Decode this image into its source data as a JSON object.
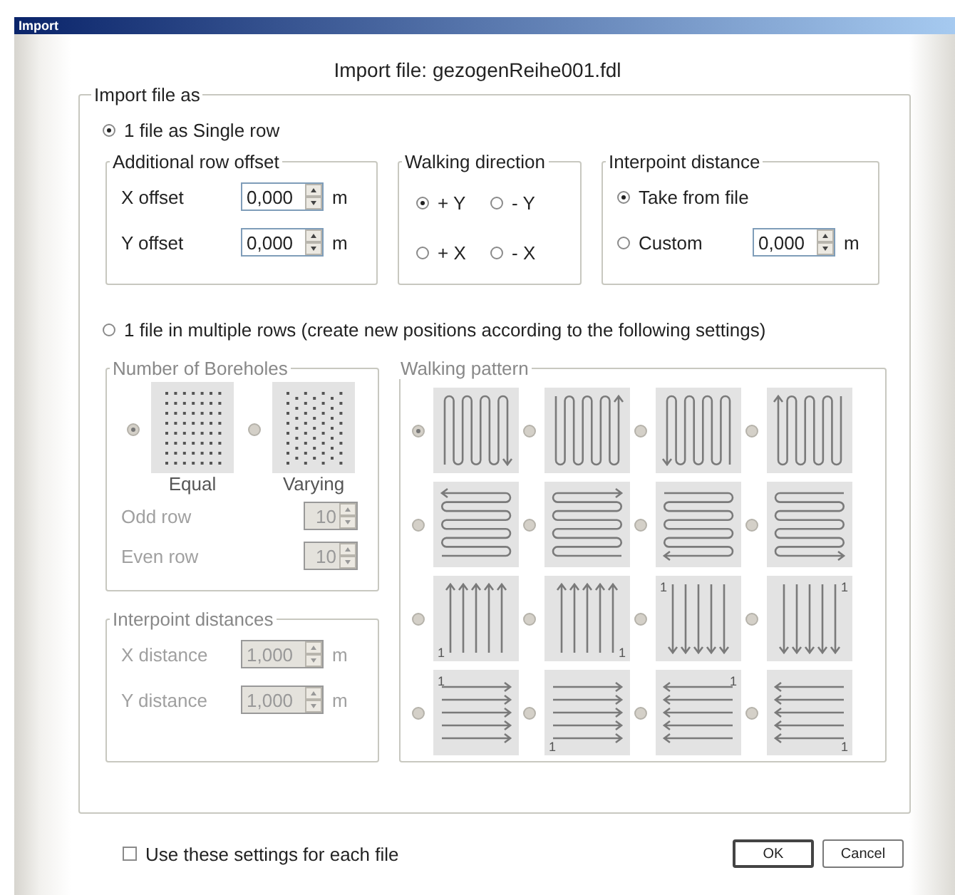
{
  "window": {
    "title": "Import"
  },
  "heading": "Import file: gezogenReihe001.fdl",
  "import_group": {
    "title": "Import file as",
    "single_row": {
      "label": "1 file as Single row",
      "selected": true
    },
    "row_offset": {
      "title": "Additional row offset",
      "fields": [
        {
          "label": "X offset",
          "value": "0,000",
          "unit": "m"
        },
        {
          "label": "Y offset",
          "value": "0,000",
          "unit": "m"
        }
      ]
    },
    "walking_direction": {
      "title": "Walking direction",
      "options": [
        {
          "label": "+ Y",
          "selected": true
        },
        {
          "label": "- Y",
          "selected": false
        },
        {
          "label": "+ X",
          "selected": false
        },
        {
          "label": "- X",
          "selected": false
        }
      ]
    },
    "interpoint_distance": {
      "title": "Interpoint distance",
      "options": [
        {
          "label": "Take from file",
          "selected": true
        },
        {
          "label": "Custom",
          "selected": false
        }
      ],
      "custom_value": "0,000",
      "unit": "m"
    },
    "multiple_rows": {
      "label": "1 file in multiple rows (create new positions according to the following settings)",
      "selected": false
    },
    "boreholes": {
      "title": "Number of Boreholes",
      "disabled": true,
      "options": [
        {
          "label": "Equal",
          "kind": "equal",
          "selected": true
        },
        {
          "label": "Varying",
          "kind": "varying",
          "selected": false
        }
      ],
      "fields": [
        {
          "label": "Odd row",
          "value": "10"
        },
        {
          "label": "Even row",
          "value": "10"
        }
      ]
    },
    "distances": {
      "title": "Interpoint distances",
      "disabled": true,
      "fields": [
        {
          "label": "X distance",
          "value": "1,000",
          "unit": "m"
        },
        {
          "label": "Y distance",
          "value": "1,000",
          "unit": "m"
        }
      ]
    },
    "walking_pattern": {
      "title": "Walking pattern",
      "disabled": true,
      "patterns": [
        {
          "kind": "serpentine-vertical",
          "mirrored": false,
          "flipped": false,
          "selected": true
        },
        {
          "kind": "serpentine-vertical",
          "mirrored": false,
          "flipped": true,
          "selected": false
        },
        {
          "kind": "serpentine-vertical",
          "mirrored": true,
          "flipped": false,
          "selected": false
        },
        {
          "kind": "serpentine-vertical",
          "mirrored": true,
          "flipped": true,
          "selected": false
        },
        {
          "kind": "serpentine-horizontal",
          "mirrored": true,
          "flipped": true,
          "selected": false
        },
        {
          "kind": "serpentine-horizontal",
          "mirrored": false,
          "flipped": true,
          "selected": false
        },
        {
          "kind": "serpentine-horizontal",
          "mirrored": true,
          "flipped": false,
          "selected": false
        },
        {
          "kind": "serpentine-horizontal",
          "mirrored": false,
          "flipped": false,
          "selected": false
        },
        {
          "kind": "parallel-vertical",
          "mirrored": false,
          "flipped": true,
          "start_label": "1",
          "selected": false
        },
        {
          "kind": "parallel-vertical",
          "mirrored": true,
          "flipped": true,
          "start_label": "1",
          "selected": false
        },
        {
          "kind": "parallel-vertical",
          "mirrored": false,
          "flipped": false,
          "start_label": "1",
          "selected": false
        },
        {
          "kind": "parallel-vertical",
          "mirrored": true,
          "flipped": false,
          "start_label": "1",
          "selected": false
        },
        {
          "kind": "parallel-horizontal",
          "mirrored": false,
          "flipped": false,
          "start_label": "1",
          "selected": false
        },
        {
          "kind": "parallel-horizontal",
          "mirrored": false,
          "flipped": true,
          "start_label": "1",
          "selected": false
        },
        {
          "kind": "parallel-horizontal",
          "mirrored": true,
          "flipped": false,
          "start_label": "1",
          "selected": false
        },
        {
          "kind": "parallel-horizontal",
          "mirrored": true,
          "flipped": true,
          "start_label": "1",
          "selected": false
        }
      ]
    }
  },
  "use_for_each": {
    "label": "Use these settings for each file",
    "checked": false
  },
  "buttons": [
    "OK",
    "Cancel"
  ]
}
